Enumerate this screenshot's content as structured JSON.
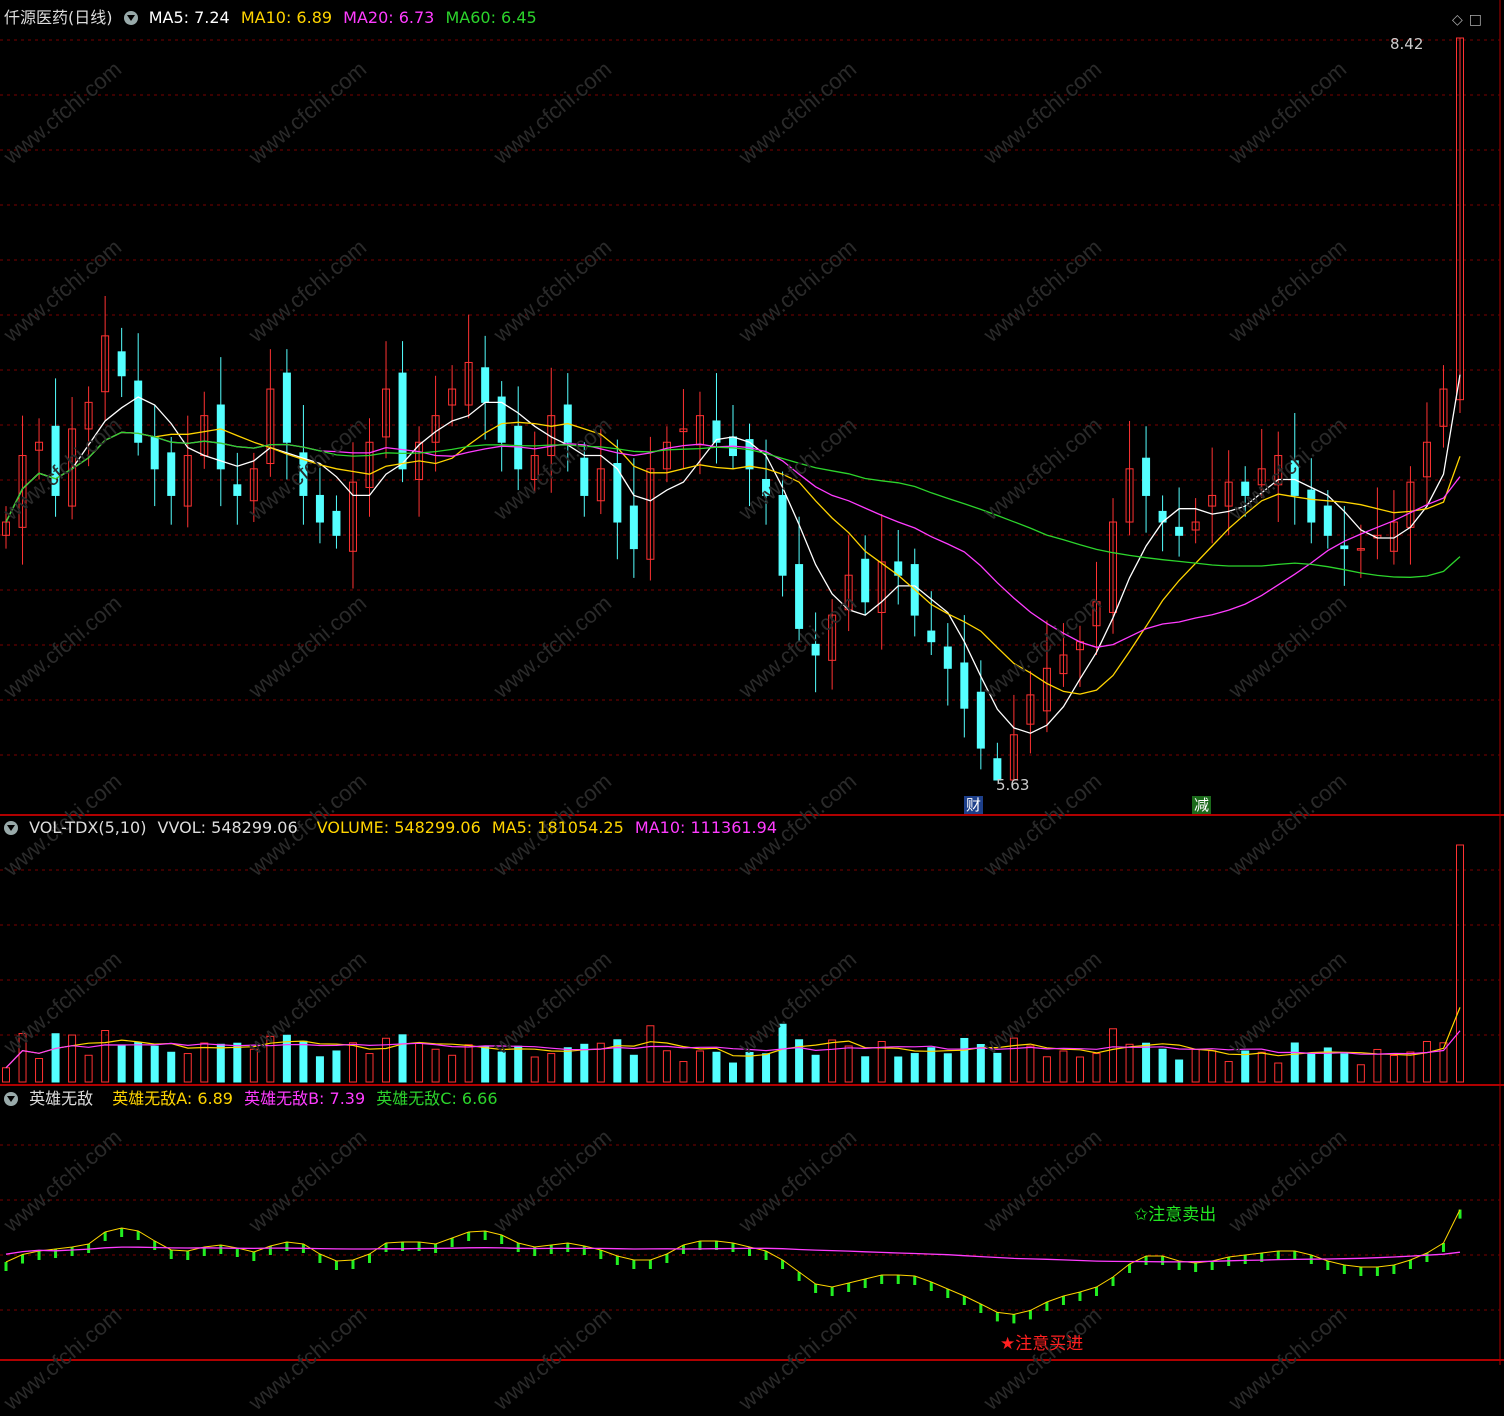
{
  "main_panel": {
    "stock_name": "仟源医药",
    "period": "(日线)",
    "ma_labels": [
      {
        "name": "MA5",
        "value": "7.24",
        "color": "#ffffff"
      },
      {
        "name": "MA10",
        "value": "6.89",
        "color": "#ffd400"
      },
      {
        "name": "MA20",
        "value": "6.73",
        "color": "#ff3cff"
      },
      {
        "name": "MA60",
        "value": "6.45",
        "color": "#2cd42c"
      }
    ],
    "high_label": "8.42",
    "low_label": "5.63",
    "tag_cai": "财",
    "tag_jian": "减"
  },
  "volume_panel": {
    "indicator": "VOL-TDX(5,10)",
    "vvol": "VVOL: 548299.06",
    "volume": "VOLUME: 548299.06",
    "ma5": "MA5: 181054.25",
    "ma10": "MA10: 111361.94"
  },
  "hero_panel": {
    "name": "英雄无敌",
    "a": "英雄无敌A: 6.89",
    "b": "英雄无敌B: 7.39",
    "c": "英雄无敌C: 6.66",
    "sell_note": "✩注意卖出",
    "buy_note": "★注意买进"
  },
  "colors": {
    "up": "#ff3232",
    "down": "#54ffff",
    "grid": "#7a0000",
    "ma5": "#ffffff",
    "ma10": "#ffd400",
    "ma20": "#ff3cff",
    "ma60": "#2cd42c"
  },
  "chart_data": [
    {
      "type": "candlestick",
      "title": "仟源医药 (日线)",
      "y_range": [
        5.63,
        8.42
      ],
      "marked_high": 8.42,
      "marked_low": 5.63,
      "closes": [
        6.6,
        6.85,
        6.9,
        6.7,
        6.95,
        7.05,
        7.3,
        7.15,
        6.9,
        6.8,
        6.7,
        6.85,
        7.0,
        6.8,
        6.7,
        6.8,
        7.1,
        6.9,
        6.7,
        6.6,
        6.55,
        6.75,
        6.9,
        7.1,
        6.8,
        6.9,
        7.0,
        7.1,
        7.2,
        7.05,
        6.9,
        6.8,
        6.85,
        7.0,
        6.9,
        6.7,
        6.8,
        6.6,
        6.5,
        6.8,
        6.9,
        6.95,
        7.0,
        6.9,
        6.85,
        6.8,
        6.7,
        6.4,
        6.2,
        6.1,
        6.25,
        6.4,
        6.3,
        6.45,
        6.4,
        6.25,
        6.15,
        6.05,
        5.9,
        5.75,
        5.63,
        5.8,
        5.95,
        6.05,
        6.1,
        6.15,
        6.3,
        6.6,
        6.8,
        6.7,
        6.6,
        6.55,
        6.6,
        6.7,
        6.75,
        6.7,
        6.8,
        6.85,
        6.7,
        6.6,
        6.55,
        6.5,
        6.5,
        6.55,
        6.6,
        6.75,
        6.9,
        7.1,
        8.42
      ],
      "ma_values": {
        "MA5": 7.24,
        "MA10": 6.89,
        "MA20": 6.73,
        "MA60": 6.45
      }
    },
    {
      "type": "bar",
      "title": "VOL-TDX(5,10)",
      "latest_volume": 548299.06,
      "ma5": 181054.25,
      "ma10": 111361.94
    },
    {
      "type": "line",
      "title": "英雄无敌",
      "A": 6.89,
      "B": 7.39,
      "C": 6.66
    }
  ]
}
